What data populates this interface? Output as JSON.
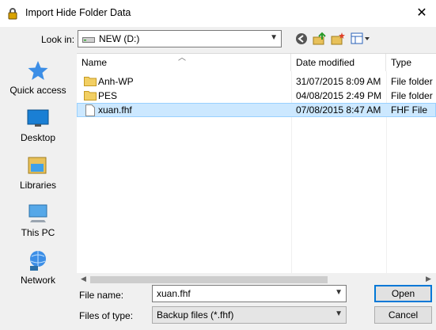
{
  "window": {
    "title": "Import Hide Folder Data",
    "close_glyph": "✕"
  },
  "lookin": {
    "label": "Look in:",
    "value": "NEW (D:)"
  },
  "toolbar": {
    "icons": [
      "back-icon",
      "up-folder-icon",
      "new-folder-icon",
      "view-menu-icon"
    ]
  },
  "places": [
    {
      "label": "Quick access",
      "icon": "quick-access-star-icon"
    },
    {
      "label": "Desktop",
      "icon": "desktop-icon"
    },
    {
      "label": "Libraries",
      "icon": "libraries-icon"
    },
    {
      "label": "This PC",
      "icon": "this-pc-icon"
    },
    {
      "label": "Network",
      "icon": "network-icon"
    }
  ],
  "filelist": {
    "columns": {
      "name": "Name",
      "date": "Date modified",
      "type": "Type"
    },
    "rows": [
      {
        "name": "Anh-WP",
        "date": "31/07/2015 8:09 AM",
        "type": "File folder",
        "kind": "folder",
        "selected": false
      },
      {
        "name": "PES",
        "date": "04/08/2015 2:49 PM",
        "type": "File folder",
        "kind": "folder",
        "selected": false
      },
      {
        "name": "xuan.fhf",
        "date": "07/08/2015 8:47 AM",
        "type": "FHF File",
        "kind": "file",
        "selected": true
      }
    ]
  },
  "filename": {
    "label": "File name:",
    "value": "xuan.fhf"
  },
  "filetype": {
    "label": "Files of type:",
    "value": "Backup files (*.fhf)"
  },
  "buttons": {
    "open": "Open",
    "cancel": "Cancel"
  },
  "colors": {
    "selection": "#cce8ff",
    "selection_border": "#99d1ff",
    "accent": "#0078d7"
  }
}
